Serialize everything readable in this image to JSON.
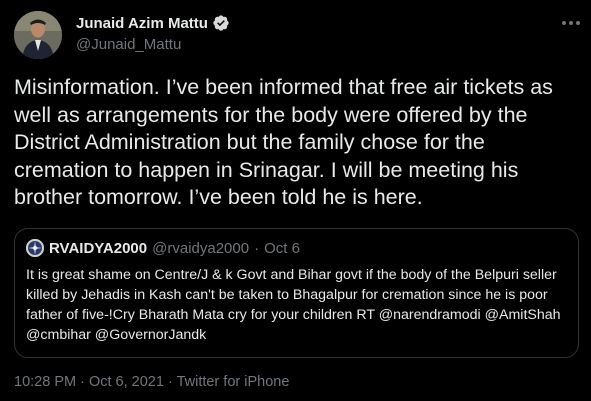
{
  "author": {
    "display_name": "Junaid Azim Mattu",
    "handle": "@Junaid_Mattu",
    "verified_icon": "verified-badge-icon",
    "more_icon": "more-options-icon"
  },
  "tweet": {
    "text": "Misinformation. I’ve been informed that free air tickets as well as arrangements for the body were offered by the District Administration but the family chose for the cremation to happen in Srinagar. I will be meeting his brother tomorrow. I’ve been told he is here."
  },
  "quoted_tweet": {
    "display_name": "RVAIDYA2000",
    "handle": "@rvaidya2000",
    "separator": "·",
    "date": "Oct 6",
    "text": "It is great shame on Centre/J & k Govt and Bihar govt if the body of the Belpuri seller killed by Jehadis in Kash can't be taken to Bhagalpur for cremation since he is poor father of five-!Cry Bharath Mata cry for your children RT @narendramodi @AmitShah @cmbihar @GovernorJandk"
  },
  "metadata": {
    "time": "10:28 PM",
    "sep1": " · ",
    "date": "Oct 6, 2021",
    "sep2": " · ",
    "source": "Twitter for iPhone"
  },
  "colors": {
    "background": "#000000",
    "primary_text": "#e7e9ea",
    "secondary_text": "#71767b",
    "border": "#2f3336",
    "verified": "#d9d9d9"
  }
}
